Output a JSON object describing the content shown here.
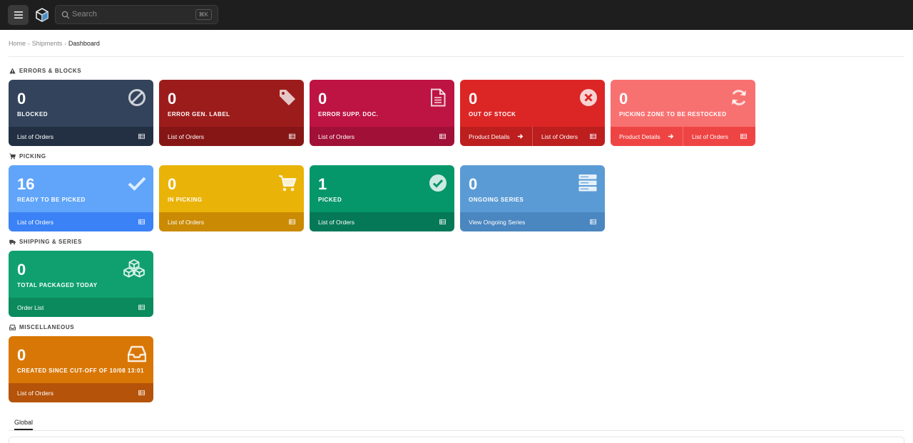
{
  "header": {
    "search_placeholder": "Search",
    "search_shortcut": "⌘K",
    "menu_icon": "hamburger-icon",
    "logo_icon": "cube-icon"
  },
  "breadcrumb": {
    "items": [
      "Home",
      "Shipments"
    ],
    "current": "Dashboard"
  },
  "sections": {
    "errors": {
      "title": "ERRORS & BLOCKS",
      "icon": "warning-icon"
    },
    "picking": {
      "title": "PICKING",
      "icon": "cart-icon"
    },
    "shipping": {
      "title": "SHIPPING & SERIES",
      "icon": "truck-icon"
    },
    "misc": {
      "title": "MISCELLANEOUS",
      "icon": "inbox-icon"
    }
  },
  "cards": {
    "blocked": {
      "value": "0",
      "label": "BLOCKED",
      "link1": "List of Orders",
      "top_color": "#33435b",
      "bottom_color": "#233044"
    },
    "error_label": {
      "value": "0",
      "label": "ERROR GEN. LABEL",
      "link1": "List of Orders",
      "top_color": "#9c1c1c",
      "bottom_color": "#861616"
    },
    "error_doc": {
      "value": "0",
      "label": "ERROR SUPP. DOC.",
      "link1": "List of Orders",
      "top_color": "#bd1443",
      "bottom_color": "#a11037"
    },
    "out_of_stock": {
      "value": "0",
      "label": "OUT OF STOCK",
      "link1": "Product Details",
      "link2": "List of Orders",
      "top_color": "#dc2626",
      "bottom_color": "#bd1e1e"
    },
    "restock": {
      "value": "0",
      "label": "PICKING ZONE TO BE RESTOCKED",
      "link1": "Product Details",
      "link2": "List of Orders",
      "top_color": "#f87171",
      "bottom_color": "#ef4444"
    },
    "ready": {
      "value": "16",
      "label": "READY TO BE PICKED",
      "link1": "List of Orders",
      "top_color": "#60a5fa",
      "bottom_color": "#3b82f6"
    },
    "in_picking": {
      "value": "0",
      "label": "IN PICKING",
      "link1": "List of Orders",
      "top_color": "#eab308",
      "bottom_color": "#ca8a04"
    },
    "picked": {
      "value": "1",
      "label": "PICKED",
      "link1": "List of Orders",
      "top_color": "#059669",
      "bottom_color": "#047857"
    },
    "ongoing": {
      "value": "0",
      "label": "ONGOING SERIES",
      "link1": "View Ongoing Series",
      "top_color": "#5b9bd5",
      "bottom_color": "#4a86c0"
    },
    "packaged": {
      "value": "0",
      "label": "TOTAL PACKAGED TODAY",
      "link1": "Order List",
      "top_color": "#10a070",
      "bottom_color": "#0b8a5e"
    },
    "created": {
      "value": "0",
      "label": "CREATED SINCE CUT-OFF OF 10/08 13:01",
      "link1": "List of Orders",
      "top_color": "#d97706",
      "bottom_color": "#b45309"
    }
  },
  "tabs": [
    {
      "label": "Global",
      "active": true
    }
  ]
}
